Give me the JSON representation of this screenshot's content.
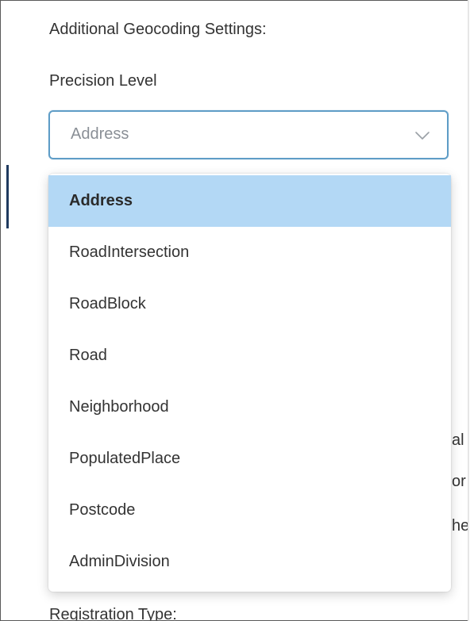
{
  "section": {
    "title": "Additional Geocoding Settings:"
  },
  "precision": {
    "label": "Precision Level",
    "selected_value": "Address",
    "chevron_icon": "chevron-down-icon",
    "options": [
      "Address",
      "RoadIntersection",
      "RoadBlock",
      "Road",
      "Neighborhood",
      "PopulatedPlace",
      "Postcode",
      "AdminDivision"
    ],
    "highlight_color": "#b3d8f5",
    "focus_border_color": "#5f9dc7"
  },
  "background": {
    "fragment_1": "al",
    "fragment_2": "or",
    "fragment_3": "he"
  },
  "registration": {
    "label": "Registration Type:"
  }
}
